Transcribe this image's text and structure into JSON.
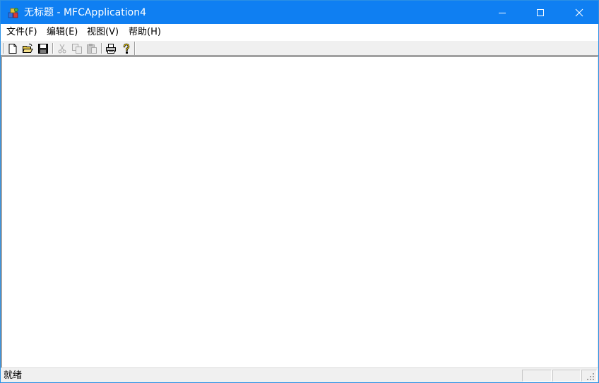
{
  "window": {
    "title": "无标题 - MFCApplication4",
    "accent_color": "#0f7ff2"
  },
  "menu": [
    {
      "label": "文件(F)"
    },
    {
      "label": "编辑(E)"
    },
    {
      "label": "视图(V)"
    },
    {
      "label": "帮助(H)"
    }
  ],
  "toolbar": {
    "buttons": [
      {
        "icon": "new-document-icon",
        "enabled": true
      },
      {
        "icon": "open-folder-icon",
        "enabled": true
      },
      {
        "icon": "save-icon",
        "enabled": true
      },
      {
        "icon": "cut-icon",
        "enabled": false
      },
      {
        "icon": "copy-icon",
        "enabled": false
      },
      {
        "icon": "paste-icon",
        "enabled": false
      },
      {
        "icon": "print-icon",
        "enabled": true
      },
      {
        "icon": "help-icon",
        "enabled": true
      }
    ]
  },
  "status": {
    "text": "就绪"
  }
}
